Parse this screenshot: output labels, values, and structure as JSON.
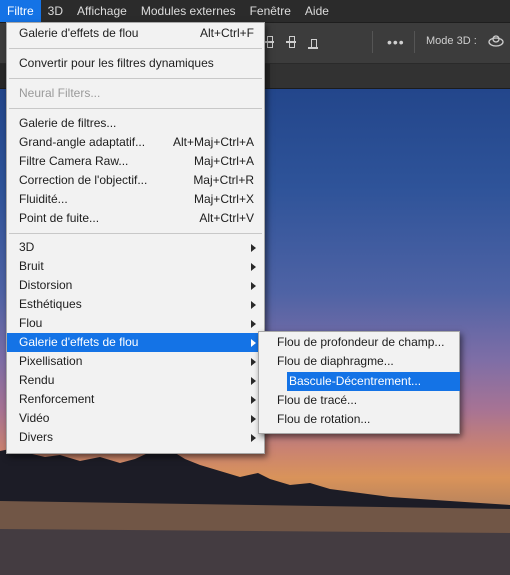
{
  "menubar": {
    "items": [
      "Filtre",
      "3D",
      "Affichage",
      "Modules externes",
      "Fenêtre",
      "Aide"
    ]
  },
  "optionsbar": {
    "mode3d_label": "Mode 3D :",
    "more_icon": "more-dots-icon"
  },
  "filter_menu": {
    "last_filter": {
      "label": "Galerie d'effets de flou",
      "shortcut": "Alt+Ctrl+F"
    },
    "convert": {
      "label": "Convertir pour les filtres dynamiques"
    },
    "neural": {
      "label": "Neural Filters..."
    },
    "items": [
      {
        "label": "Galerie de filtres...",
        "shortcut": ""
      },
      {
        "label": "Grand-angle adaptatif...",
        "shortcut": "Alt+Maj+Ctrl+A"
      },
      {
        "label": "Filtre Camera Raw...",
        "shortcut": "Maj+Ctrl+A"
      },
      {
        "label": "Correction de l'objectif...",
        "shortcut": "Maj+Ctrl+R"
      },
      {
        "label": "Fluidité...",
        "shortcut": "Maj+Ctrl+X"
      },
      {
        "label": "Point de fuite...",
        "shortcut": "Alt+Ctrl+V"
      }
    ],
    "submenus": [
      "3D",
      "Bruit",
      "Distorsion",
      "Esthétiques",
      "Flou",
      "Galerie d'effets de flou",
      "Pixellisation",
      "Rendu",
      "Renforcement",
      "Vidéo",
      "Divers"
    ]
  },
  "blur_gallery_submenu": {
    "items": [
      "Flou de profondeur de champ...",
      "Flou de diaphragme...",
      "Bascule-Décentrement...",
      "Flou de tracé...",
      "Flou de rotation..."
    ]
  },
  "colors": {
    "highlight": "#1473e6"
  }
}
